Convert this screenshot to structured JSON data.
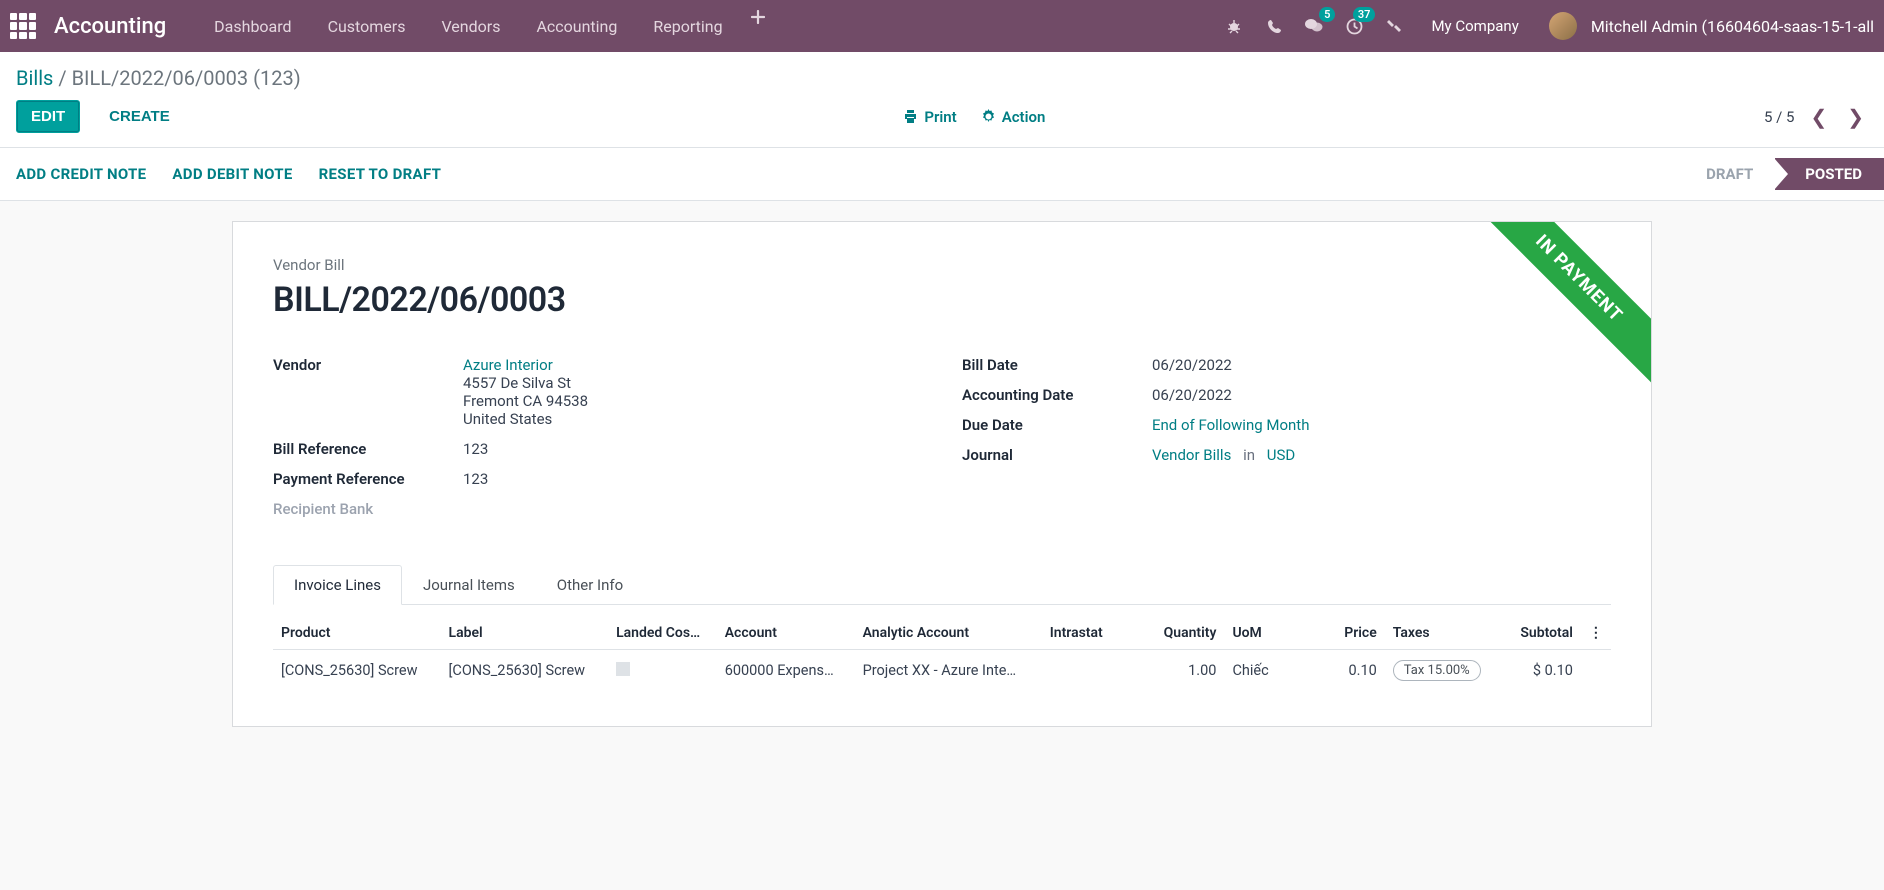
{
  "navbar": {
    "brand": "Accounting",
    "menu": [
      "Dashboard",
      "Customers",
      "Vendors",
      "Accounting",
      "Reporting"
    ],
    "chat_badge": "5",
    "clock_badge": "37",
    "company": "My Company",
    "user": "Mitchell Admin (16604604-saas-15-1-all"
  },
  "breadcrumb": {
    "root": "Bills",
    "sep": " / ",
    "current": "BILL/2022/06/0003 (123)"
  },
  "cp": {
    "edit": "EDIT",
    "create": "CREATE",
    "print": "Print",
    "action": "Action",
    "pager": "5 / 5"
  },
  "statusbar": {
    "actions": [
      "ADD CREDIT NOTE",
      "ADD DEBIT NOTE",
      "RESET TO DRAFT"
    ],
    "draft": "DRAFT",
    "posted": "POSTED"
  },
  "ribbon": "IN PAYMENT",
  "doc": {
    "label": "Vendor Bill",
    "title": "BILL/2022/06/0003"
  },
  "left_fields": {
    "vendor_label": "Vendor",
    "vendor_name": "Azure Interior",
    "vendor_street": "4557 De Silva St",
    "vendor_city": "Fremont CA 94538",
    "vendor_country": "United States",
    "billref_label": "Bill Reference",
    "billref_value": "123",
    "payref_label": "Payment Reference",
    "payref_value": "123",
    "recbank_label": "Recipient Bank"
  },
  "right_fields": {
    "billdate_label": "Bill Date",
    "billdate_value": "06/20/2022",
    "accdate_label": "Accounting Date",
    "accdate_value": "06/20/2022",
    "duedate_label": "Due Date",
    "duedate_value": "End of Following Month",
    "journal_label": "Journal",
    "journal_value": "Vendor Bills",
    "journal_in": "in",
    "journal_currency": "USD"
  },
  "tabs": [
    "Invoice Lines",
    "Journal Items",
    "Other Info"
  ],
  "table": {
    "headers": {
      "product": "Product",
      "label": "Label",
      "landed": "Landed Cos…",
      "account": "Account",
      "analytic": "Analytic Account",
      "intrastat": "Intrastat",
      "quantity": "Quantity",
      "uom": "UoM",
      "price": "Price",
      "taxes": "Taxes",
      "subtotal": "Subtotal"
    },
    "row": {
      "product": "[CONS_25630] Screw",
      "label": "[CONS_25630] Screw",
      "account": "600000 Expens…",
      "analytic": "Project XX - Azure Inte…",
      "intrastat": "",
      "quantity": "1.00",
      "uom": "Chiếc",
      "price": "0.10",
      "taxes": "Tax 15.00%",
      "subtotal": "$ 0.10"
    }
  }
}
